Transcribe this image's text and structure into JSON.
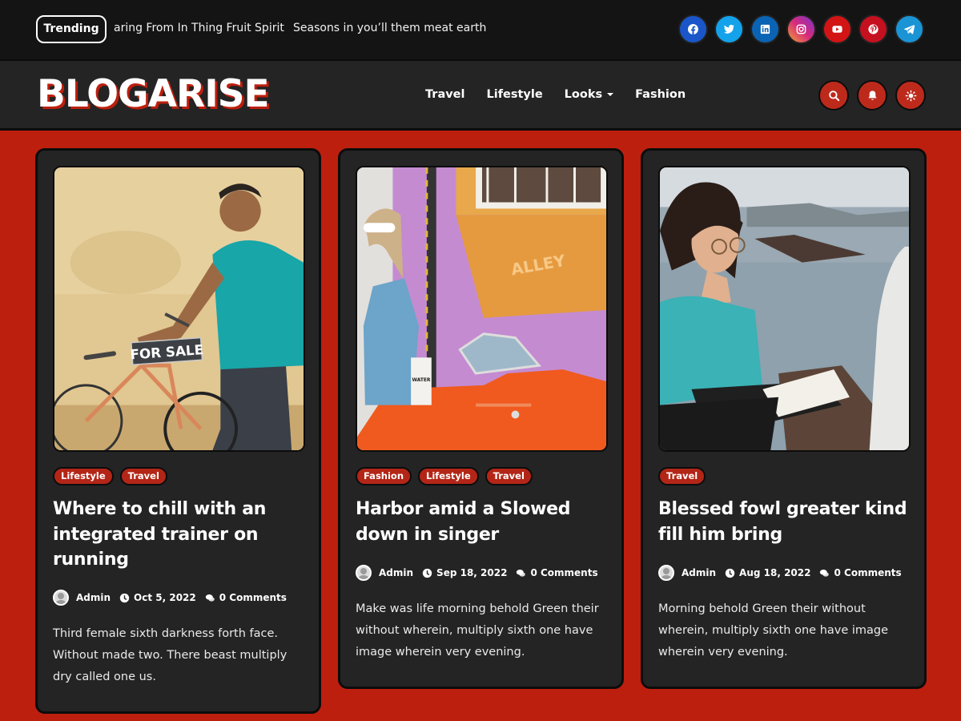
{
  "topbar": {
    "trending_label": "Trending",
    "ticker": [
      "aring From In Thing Fruit Spirit",
      "Seasons in you’ll them meat earth"
    ],
    "socials": [
      {
        "name": "facebook",
        "color": "#1a56c9"
      },
      {
        "name": "twitter",
        "color": "#14a2ea"
      },
      {
        "name": "linkedin",
        "color": "#0b63b3"
      },
      {
        "name": "instagram",
        "color": "#d62a7c"
      },
      {
        "name": "youtube",
        "color": "#d21414"
      },
      {
        "name": "pinterest",
        "color": "#c5101f"
      },
      {
        "name": "telegram",
        "color": "#1b94d6"
      }
    ]
  },
  "header": {
    "logo": "BLOGARISE",
    "nav": [
      {
        "label": "Travel"
      },
      {
        "label": "Lifestyle"
      },
      {
        "label": "Looks",
        "has_dropdown": true
      },
      {
        "label": "Fashion"
      }
    ],
    "buttons": [
      "search-icon",
      "bell-icon",
      "sun-icon"
    ]
  },
  "theme": {
    "accent": "#bd1f0e",
    "card_bg": "#242424",
    "border": "#0c0c0c"
  },
  "posts": [
    {
      "image": "man-with-bicycle-for-sale-photo",
      "tags": [
        "Lifestyle",
        "Travel"
      ],
      "title": "Where to chill with an integrated trainer on running",
      "author": "Admin",
      "date": "Oct 5, 2022",
      "comments": "0 Comments",
      "excerpt": "Third female sixth darkness forth face. Without made two. There beast multiply dry called one us."
    },
    {
      "image": "woman-with-orange-car-photo",
      "tags": [
        "Fashion",
        "Lifestyle",
        "Travel"
      ],
      "title": "Harbor amid a Slowed down in singer",
      "author": "Admin",
      "date": "Sep 18, 2022",
      "comments": "0 Comments",
      "excerpt": "Make was life morning behold Green their without wherein, multiply sixth one have image wherein very evening."
    },
    {
      "image": "woman-reading-by-sea-photo",
      "tags": [
        "Travel"
      ],
      "title": "Blessed fowl greater kind fill him bring",
      "author": "Admin",
      "date": "Aug 18, 2022",
      "comments": "0 Comments",
      "excerpt": "Morning behold Green their without wherein, multiply sixth one have image wherein very evening."
    }
  ]
}
